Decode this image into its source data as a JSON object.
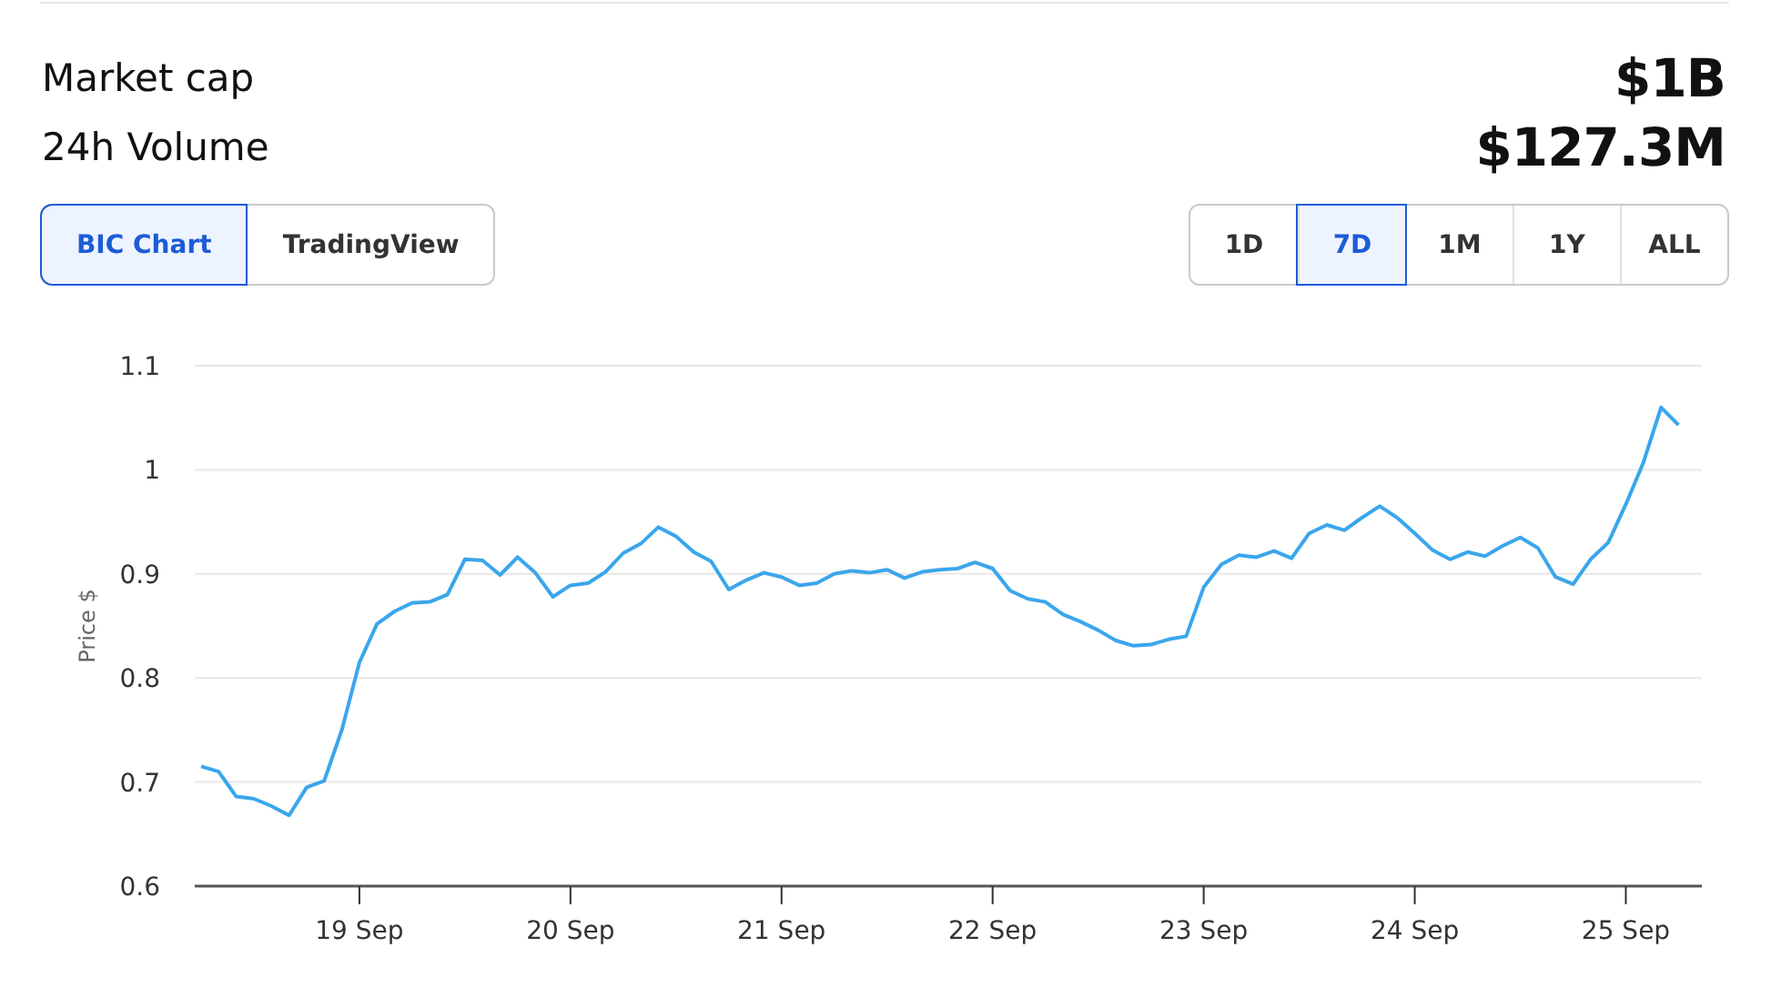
{
  "stats": [
    {
      "label": "Market cap",
      "value": "$1B"
    },
    {
      "label": "24h Volume",
      "value": "$127.3M"
    }
  ],
  "chart_sources": [
    {
      "label": "BIC Chart",
      "selected": true
    },
    {
      "label": "TradingView",
      "selected": false
    }
  ],
  "ranges": [
    {
      "label": "1D",
      "selected": false
    },
    {
      "label": "7D",
      "selected": true
    },
    {
      "label": "1M",
      "selected": false
    },
    {
      "label": "1Y",
      "selected": false
    },
    {
      "label": "ALL",
      "selected": false
    }
  ],
  "chart_data": {
    "type": "line",
    "grid": true,
    "ylabel": "Price $",
    "ylim": [
      0.6,
      1.1
    ],
    "yticks": [
      0.6,
      0.7,
      0.8,
      0.9,
      1,
      1.1
    ],
    "categories": [
      null,
      null,
      null,
      null,
      null,
      null,
      null,
      null,
      null,
      "19 Sep",
      null,
      null,
      null,
      null,
      null,
      null,
      null,
      null,
      null,
      null,
      null,
      "20 Sep",
      null,
      null,
      null,
      null,
      null,
      null,
      null,
      null,
      null,
      null,
      null,
      "21 Sep",
      null,
      null,
      null,
      null,
      null,
      null,
      null,
      null,
      null,
      null,
      null,
      "22 Sep",
      null,
      null,
      null,
      null,
      null,
      null,
      null,
      null,
      null,
      null,
      null,
      "23 Sep",
      null,
      null,
      null,
      null,
      null,
      null,
      null,
      null,
      null,
      null,
      null,
      "24 Sep",
      null,
      null,
      null,
      null,
      null,
      null,
      null,
      null,
      null,
      null,
      null,
      "25 Sep",
      null,
      null,
      null
    ],
    "series": [
      {
        "color": "#3aa6ec",
        "values": [
          0.715,
          0.71,
          0.686,
          0.684,
          0.677,
          0.668,
          0.695,
          0.701,
          0.75,
          0.815,
          0.852,
          0.864,
          0.872,
          0.873,
          0.88,
          0.914,
          0.913,
          0.899,
          0.916,
          0.901,
          0.878,
          0.889,
          0.891,
          0.902,
          0.92,
          0.929,
          0.945,
          0.936,
          0.921,
          0.912,
          0.885,
          0.894,
          0.901,
          0.897,
          0.889,
          0.891,
          0.9,
          0.903,
          0.901,
          0.904,
          0.896,
          0.902,
          0.904,
          0.905,
          0.911,
          0.905,
          0.884,
          0.876,
          0.873,
          0.861,
          0.854,
          0.846,
          0.836,
          0.831,
          0.832,
          0.837,
          0.84,
          0.887,
          0.909,
          0.918,
          0.916,
          0.922,
          0.915,
          0.939,
          0.947,
          0.942,
          0.954,
          0.965,
          0.954,
          0.939,
          0.923,
          0.914,
          0.921,
          0.917,
          0.927,
          0.935,
          0.925,
          0.897,
          0.89,
          0.914,
          0.93,
          0.967,
          1.007,
          1.06,
          1.043
        ]
      }
    ]
  }
}
